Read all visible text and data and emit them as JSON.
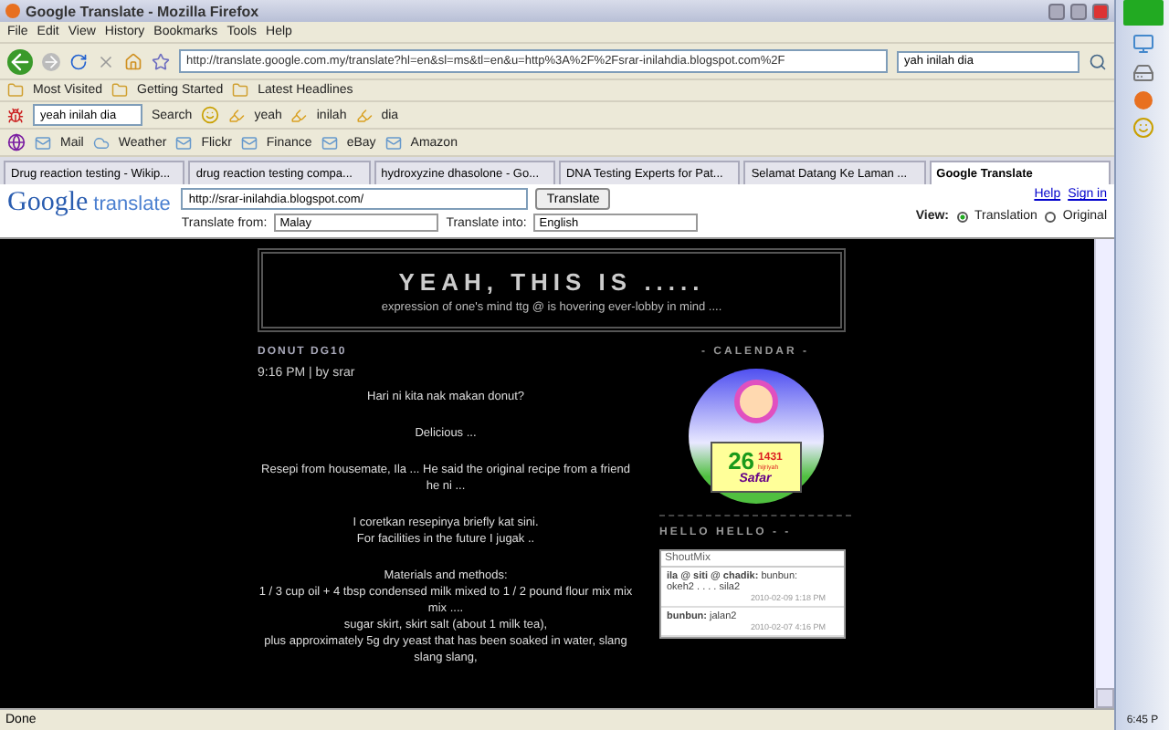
{
  "window": {
    "title": "Google Translate - Mozilla Firefox"
  },
  "menu": [
    "File",
    "Edit",
    "View",
    "History",
    "Bookmarks",
    "Tools",
    "Help"
  ],
  "nav": {
    "url": "http://translate.google.com.my/translate?hl=en&sl=ms&tl=en&u=http%3A%2F%2Fsrar-inilahdia.blogspot.com%2F",
    "search": "yah inilah dia"
  },
  "bookmarks": [
    "Most Visited",
    "Getting Started",
    "Latest Headlines"
  ],
  "toolbar": {
    "field": "yeah inilah dia",
    "search": "Search",
    "words": [
      "yeah",
      "inilah",
      "dia"
    ]
  },
  "yahoo_bar": [
    "Mail",
    "Weather",
    "Flickr",
    "Finance",
    "eBay",
    "Amazon"
  ],
  "tabs": [
    {
      "label": "Drug reaction testing - Wikip...",
      "selected": false
    },
    {
      "label": "drug reaction testing compa...",
      "selected": false
    },
    {
      "label": "hydroxyzine dhasolone - Go...",
      "selected": false
    },
    {
      "label": "DNA Testing Experts for Pat...",
      "selected": false
    },
    {
      "label": "Selamat Datang Ke Laman ...",
      "selected": false
    },
    {
      "label": "Google Translate",
      "selected": true
    }
  ],
  "translate": {
    "logo_google": "Google",
    "logo_translate": "translate",
    "url": "http://srar-inilahdia.blogspot.com/",
    "button": "Translate",
    "from_label": "Translate from:",
    "from": "Malay",
    "into_label": "Translate into:",
    "into": "English",
    "help": "Help",
    "signin": "Sign in",
    "view_label": "View:",
    "views": [
      {
        "label": "Translation",
        "selected": true
      },
      {
        "label": "Original",
        "selected": false
      }
    ]
  },
  "blog": {
    "title": "YEAH, THIS IS .....",
    "subtitle": "expression of one's mind ttg @ is hovering ever-lobby in mind ....",
    "post_title": "DONUT DG10",
    "post_meta": "9:16 PM | by srar",
    "paragraphs": [
      [
        "Hari ni kita nak makan donut?"
      ],
      [
        "Delicious ..."
      ],
      [
        "Resepi from housemate, Ila ... He said the original recipe from a friend he ni ..."
      ],
      [
        "I coretkan resepinya briefly kat sini.",
        "For facilities in the future I jugak .."
      ],
      [
        "Materials and methods:",
        "1 / 3 cup oil + 4 tbsp condensed milk mixed to 1 / 2 pound flour mix mix mix ....",
        "sugar skirt, skirt salt (about 1 milk tea),",
        "plus approximately 5g dry yeast that has been soaked in water, slang slang slang,"
      ]
    ],
    "calendar_heading": "- CALENDAR -",
    "calendar": {
      "day": "26",
      "year": "1431",
      "era": "hijriyah",
      "month": "Safar"
    },
    "hello_heading": "HELLO HELLO - -",
    "shoutmix": {
      "title": "ShoutMix",
      "messages": [
        {
          "author": "ila @ siti @ chadik:",
          "text": "bunbun: okeh2 . . . . sila2",
          "time": "2010-02-09 1:18 PM"
        },
        {
          "author": "bunbun:",
          "text": "jalan2",
          "time": "2010-02-07 4:16 PM"
        }
      ]
    }
  },
  "status": "Done",
  "clock": "6:45 P"
}
